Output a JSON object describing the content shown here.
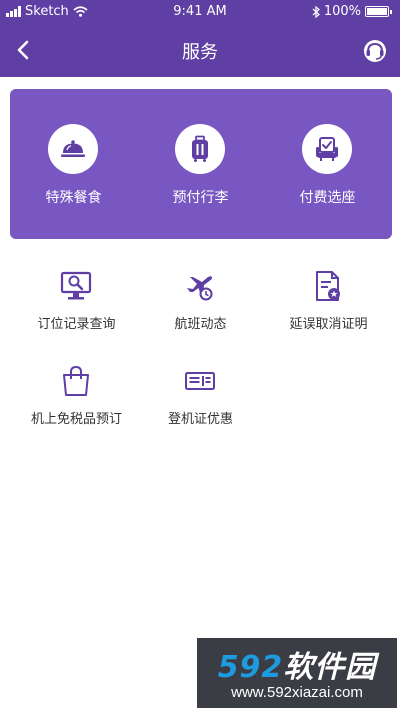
{
  "status_bar": {
    "carrier": "Sketch",
    "time": "9:41 AM",
    "battery": "100%"
  },
  "nav": {
    "title": "服务",
    "back_icon": "chevron-left-icon",
    "service_icon": "customer-service-icon"
  },
  "featured": [
    {
      "label": "特殊餐食",
      "icon": "meal-cloche-icon"
    },
    {
      "label": "预付行李",
      "icon": "luggage-icon"
    },
    {
      "label": "付费选座",
      "icon": "seat-icon"
    }
  ],
  "services": [
    {
      "label": "订位记录查询",
      "icon": "booking-search-icon"
    },
    {
      "label": "航班动态",
      "icon": "flight-status-icon"
    },
    {
      "label": "延误取消证明",
      "icon": "delay-certificate-icon"
    },
    {
      "label": "机上免税品预订",
      "icon": "duty-free-bag-icon"
    },
    {
      "label": "登机证优惠",
      "icon": "boarding-pass-icon"
    }
  ],
  "watermark": {
    "logo_num": "592",
    "logo_text": "软件园",
    "url": "www.592xiazai.com"
  },
  "colors": {
    "header": "#5f3fa3",
    "featured_bg": "#7857c3",
    "icon_purple": "#5f3fa3"
  }
}
